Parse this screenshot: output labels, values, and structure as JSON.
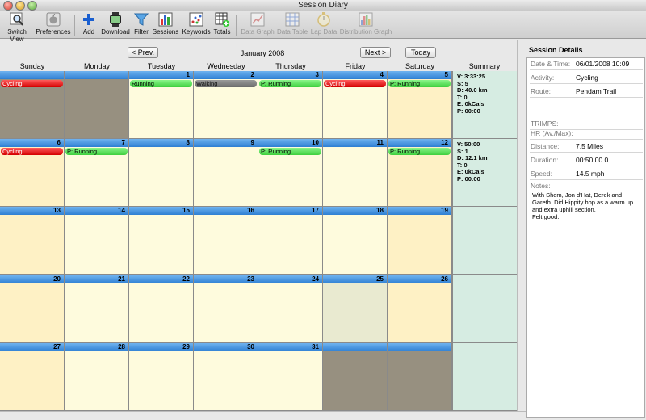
{
  "window": {
    "title": "Session Diary"
  },
  "toolbar": [
    {
      "id": "switch-view",
      "label": "Switch View",
      "icon": "magnifier-icon",
      "enabled": true
    },
    {
      "id": "preferences",
      "label": "Preferences",
      "icon": "apple-icon",
      "enabled": true
    },
    {
      "id": "add",
      "label": "Add",
      "icon": "plus-icon",
      "enabled": true
    },
    {
      "id": "download",
      "label": "Download",
      "icon": "watch-icon",
      "enabled": true
    },
    {
      "id": "filter",
      "label": "Filter",
      "icon": "funnel-icon",
      "enabled": true
    },
    {
      "id": "sessions",
      "label": "Sessions",
      "icon": "bar-chart-icon",
      "enabled": true
    },
    {
      "id": "keywords",
      "label": "Keywords",
      "icon": "scatter-icon",
      "enabled": true
    },
    {
      "id": "totals",
      "label": "Totals",
      "icon": "table-plus-icon",
      "enabled": true
    },
    {
      "id": "data-graph",
      "label": "Data Graph",
      "icon": "line-graph-icon",
      "enabled": false
    },
    {
      "id": "data-table",
      "label": "Data Table",
      "icon": "grid-table-icon",
      "enabled": false
    },
    {
      "id": "lap-data",
      "label": "Lap Data",
      "icon": "stopwatch-icon",
      "enabled": false
    },
    {
      "id": "distribution-graph",
      "label": "Distribution Graph",
      "icon": "histogram-icon",
      "enabled": false
    }
  ],
  "nav": {
    "prev": "< Prev.",
    "month": "January 2008",
    "next": "Next >",
    "today": "Today"
  },
  "days": [
    "Sunday",
    "Monday",
    "Tuesday",
    "Wednesday",
    "Thursday",
    "Friday",
    "Saturday"
  ],
  "summary_header": "Summary",
  "colors": {
    "weekday": "#fefbdd",
    "weekend": "#fef1c5",
    "outside": "#979080",
    "today": "#e9ead0",
    "summary": "#d6ece2",
    "header_bar": "#2e7fd3"
  },
  "weeks": [
    {
      "cells": [
        {
          "date": "",
          "kind": "outside-selected",
          "sessions": [
            {
              "label": "Cycling",
              "color": "red"
            }
          ]
        },
        {
          "date": "",
          "kind": "outside",
          "sessions": []
        },
        {
          "date": "1",
          "kind": "weekday",
          "sessions": [
            {
              "label": "Running",
              "color": "green"
            }
          ]
        },
        {
          "date": "2",
          "kind": "weekday",
          "sessions": [
            {
              "label": "Walking",
              "color": "gray"
            }
          ]
        },
        {
          "date": "3",
          "kind": "weekday",
          "sessions": [
            {
              "label": "P: Running",
              "color": "green"
            }
          ]
        },
        {
          "date": "4",
          "kind": "weekday",
          "sessions": [
            {
              "label": "Cycling",
              "color": "red"
            }
          ]
        },
        {
          "date": "5",
          "kind": "weekend",
          "sessions": [
            {
              "label": "P: Running",
              "color": "green"
            }
          ]
        }
      ],
      "summary": [
        "V: 3:33:25",
        "S: 5",
        "D: 40.0 km",
        "T: 0",
        "E: 0kCals",
        "P: 00:00"
      ]
    },
    {
      "cells": [
        {
          "date": "6",
          "kind": "weekend",
          "sessions": [
            {
              "label": "Cycling",
              "color": "red"
            }
          ]
        },
        {
          "date": "7",
          "kind": "weekday",
          "sessions": [
            {
              "label": "P: Running",
              "color": "green"
            }
          ]
        },
        {
          "date": "8",
          "kind": "weekday",
          "sessions": []
        },
        {
          "date": "9",
          "kind": "weekday",
          "sessions": []
        },
        {
          "date": "10",
          "kind": "weekday",
          "sessions": [
            {
              "label": "P: Running",
              "color": "green"
            }
          ]
        },
        {
          "date": "11",
          "kind": "weekday",
          "sessions": []
        },
        {
          "date": "12",
          "kind": "weekend",
          "sessions": [
            {
              "label": "P: Running",
              "color": "green"
            }
          ]
        }
      ],
      "summary": [
        "V: 50:00",
        "S: 1",
        "D: 12.1 km",
        "T: 0",
        "E: 0kCals",
        "P: 00:00"
      ]
    },
    {
      "cells": [
        {
          "date": "13",
          "kind": "weekend",
          "sessions": []
        },
        {
          "date": "14",
          "kind": "weekday",
          "sessions": []
        },
        {
          "date": "15",
          "kind": "weekday",
          "sessions": []
        },
        {
          "date": "16",
          "kind": "weekday",
          "sessions": []
        },
        {
          "date": "17",
          "kind": "weekday",
          "sessions": []
        },
        {
          "date": "18",
          "kind": "weekday",
          "sessions": []
        },
        {
          "date": "19",
          "kind": "weekend",
          "sessions": []
        }
      ],
      "summary": []
    },
    {
      "cells": [
        {
          "date": "20",
          "kind": "weekend",
          "sessions": []
        },
        {
          "date": "21",
          "kind": "weekday",
          "sessions": []
        },
        {
          "date": "22",
          "kind": "weekday",
          "sessions": []
        },
        {
          "date": "23",
          "kind": "weekday",
          "sessions": []
        },
        {
          "date": "24",
          "kind": "weekday",
          "sessions": []
        },
        {
          "date": "25",
          "kind": "today",
          "sessions": []
        },
        {
          "date": "26",
          "kind": "weekend",
          "sessions": []
        }
      ],
      "summary": []
    },
    {
      "cells": [
        {
          "date": "27",
          "kind": "weekend",
          "sessions": []
        },
        {
          "date": "28",
          "kind": "weekday",
          "sessions": []
        },
        {
          "date": "29",
          "kind": "weekday",
          "sessions": []
        },
        {
          "date": "30",
          "kind": "weekday",
          "sessions": []
        },
        {
          "date": "31",
          "kind": "weekday",
          "sessions": []
        },
        {
          "date": "",
          "kind": "outside",
          "sessions": []
        },
        {
          "date": "",
          "kind": "outside",
          "sessions": []
        }
      ],
      "summary": []
    }
  ],
  "details": {
    "title": "Session Details",
    "fields": [
      {
        "label": "Date & Time:",
        "value": "06/01/2008 10:09"
      },
      {
        "label": "Activity:",
        "value": "Cycling"
      },
      {
        "label": "Route:",
        "value": "Pendam Trail"
      },
      {
        "label": "TRIMPS:",
        "value": ""
      },
      {
        "label": "HR (Av./Max):",
        "value": ""
      },
      {
        "label": "Distance:",
        "value": "7.5 Miles"
      },
      {
        "label": "Duration:",
        "value": "00:50:00.0"
      },
      {
        "label": "Speed:",
        "value": "14.5 mph"
      }
    ],
    "notes_label": "Notes:",
    "notes": "With Shem, Jon d'Hat, Derek and Gareth. Did Hippity hop as a warm up and extra uphill section.\nFelt good."
  }
}
